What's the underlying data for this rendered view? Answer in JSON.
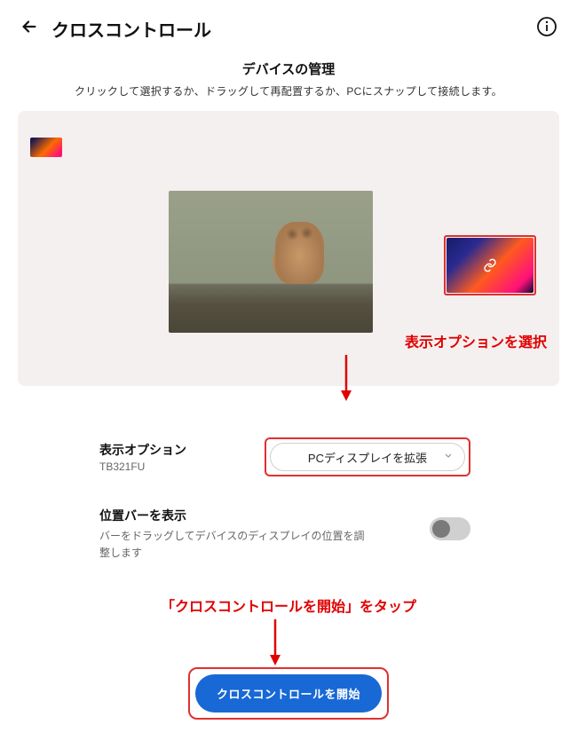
{
  "header": {
    "title": "クロスコントロール"
  },
  "subheader": {
    "title": "デバイスの管理",
    "description": "クリックして選択するか、ドラッグして再配置するか、PCにスナップして接続します。"
  },
  "display_options": {
    "label": "表示オプション",
    "device_name": "TB321FU",
    "selected": "PCディスプレイを拡張"
  },
  "position_bar": {
    "label": "位置バーを表示",
    "description": "バーをドラッグしてデバイスのディスプレイの位置を調整します",
    "enabled": false
  },
  "annotations": {
    "select_display_option": "表示オプションを選択",
    "tap_start": "「クロスコントロールを開始」をタップ"
  },
  "actions": {
    "start_button": "クロスコントロールを開始"
  },
  "colors": {
    "annotation_red": "#e10000",
    "highlight_border": "#e03030",
    "primary_button": "#1868d6"
  }
}
